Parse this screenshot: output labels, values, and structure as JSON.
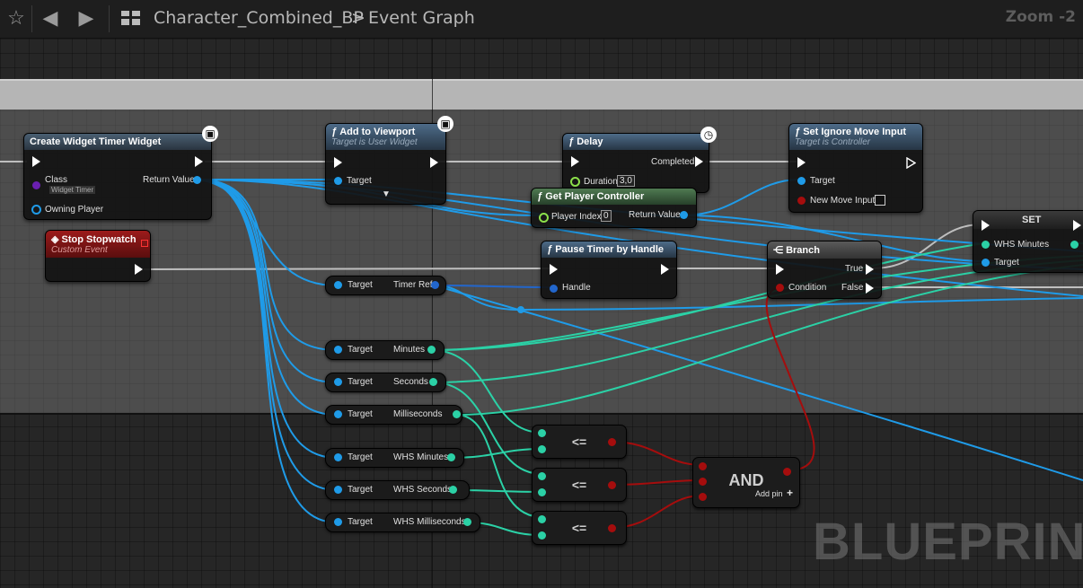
{
  "toolbar": {
    "star_icon": "star-icon",
    "back_icon": "back-arrow-icon",
    "forward_icon": "forward-arrow-icon",
    "graph_icon": "blueprint-graph-icon",
    "blueprint_name": "Character_Combined_BP",
    "separator": ">",
    "graph_name": "Event Graph",
    "zoom": "Zoom -2"
  },
  "watermark": "BLUEPRINT",
  "colors": {
    "object_pin": "#1f9be8",
    "float_pin": "#2bd1a6",
    "bool_pin": "#a50d0d",
    "exec_pin": "#ffffff"
  },
  "nodes": {
    "create_widget": {
      "title": "Create Widget Timer Widget",
      "class_label": "Class",
      "class_value": "Widget Timer",
      "return_label": "Return Value",
      "owner_label": "Owning Player"
    },
    "add_viewport": {
      "title": "Add to Viewport",
      "subtitle": "Target is User Widget",
      "target": "Target"
    },
    "delay": {
      "title": "Delay",
      "completed": "Completed",
      "duration_label": "Duration",
      "duration_value": "3,0"
    },
    "set_ignore": {
      "title": "Set Ignore Move Input",
      "subtitle": "Target is Controller",
      "target": "Target",
      "new_input": "New Move Input"
    },
    "get_pc": {
      "title": "Get Player Controller",
      "player_index": "Player Index",
      "index_value": "0",
      "return_label": "Return Value"
    },
    "stop_watch": {
      "title": "Stop Stopwatch",
      "subtitle": "Custom Event"
    },
    "pause_timer": {
      "title": "Pause Timer by Handle",
      "handle": "Handle"
    },
    "branch": {
      "title": "Branch",
      "condition": "Condition",
      "true_label": "True",
      "false_label": "False"
    },
    "set": {
      "title": "SET",
      "whs_minutes": "WHS Minutes",
      "target": "Target"
    },
    "and_node": {
      "title": "AND",
      "add_pin": "Add pin"
    }
  },
  "vars": [
    {
      "left": "Target",
      "right": "Timer Ref"
    },
    {
      "left": "Target",
      "right": "Minutes"
    },
    {
      "left": "Target",
      "right": "Seconds"
    },
    {
      "left": "Target",
      "right": "Milliseconds"
    },
    {
      "left": "Target",
      "right": "WHS Minutes"
    },
    {
      "left": "Target",
      "right": "WHS Seconds"
    },
    {
      "left": "Target",
      "right": "WHS Milliseconds"
    }
  ],
  "compare_ops": [
    "<=",
    "<=",
    "<="
  ]
}
